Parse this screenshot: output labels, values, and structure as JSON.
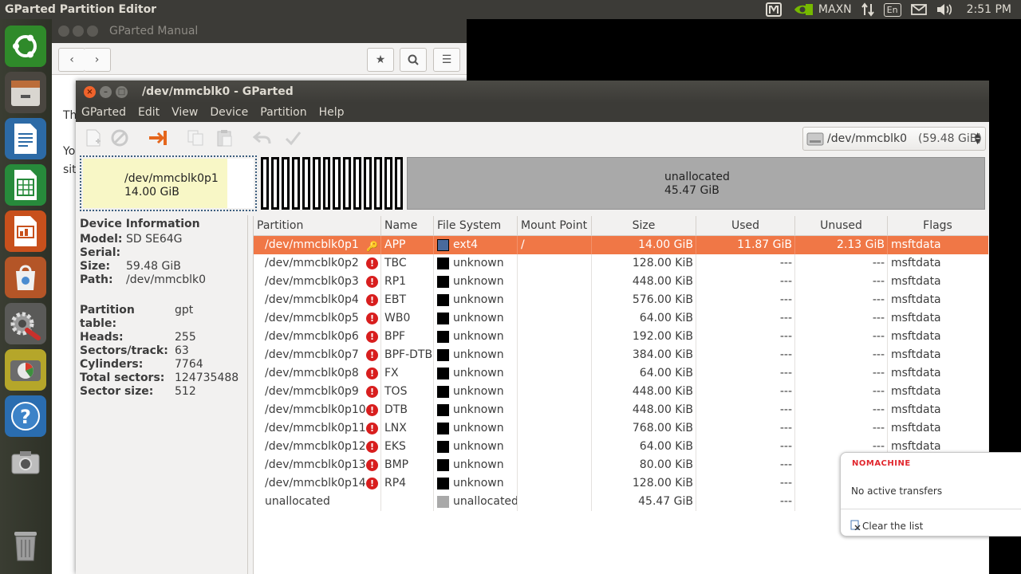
{
  "top_panel": {
    "app_title": "GParted Partition Editor",
    "keyboard_indicator": "MAXN",
    "language": "En",
    "clock": "2:51 PM"
  },
  "launcher": {
    "items": [
      "ubuntu-dash",
      "files",
      "writer",
      "calc",
      "impress",
      "software-center",
      "system-settings",
      "gparted",
      "help",
      "screenshot",
      "trash"
    ]
  },
  "manual_window": {
    "title": "GParted Manual",
    "body_lines": [
      "Th",
      "Yo",
      "sit"
    ]
  },
  "gparted": {
    "title": "/dev/mmcblk0 - GParted",
    "menu": [
      "GParted",
      "Edit",
      "View",
      "Device",
      "Partition",
      "Help"
    ],
    "device_selector": {
      "device": "/dev/mmcblk0",
      "size": "(59.48 GiB)"
    },
    "map": {
      "p1_name": "/dev/mmcblk0p1",
      "p1_size": "14.00 GiB",
      "p1_used_fraction": 0.848,
      "unalloc_name": "unallocated",
      "unalloc_size": "45.47 GiB"
    },
    "device_info": {
      "header": "Device Information",
      "group1": [
        {
          "k": "Model:",
          "v": "SD SE64G"
        },
        {
          "k": "Serial:",
          "v": ""
        },
        {
          "k": "Size:",
          "v": "59.48 GiB"
        },
        {
          "k": "Path:",
          "v": "/dev/mmcblk0"
        }
      ],
      "group2": [
        {
          "k": "Partition table:",
          "v": "gpt"
        },
        {
          "k": "Heads:",
          "v": "255"
        },
        {
          "k": "Sectors/track:",
          "v": "63"
        },
        {
          "k": "Cylinders:",
          "v": "7764"
        },
        {
          "k": "Total sectors:",
          "v": "124735488"
        },
        {
          "k": "Sector size:",
          "v": "512"
        }
      ]
    },
    "columns": [
      "Partition",
      "Name",
      "File System",
      "Mount Point",
      "Size",
      "Used",
      "Unused",
      "Flags"
    ],
    "rows": [
      {
        "p": "/dev/mmcblk0p1",
        "n": "APP",
        "fs": "ext4",
        "fsc": "#4a6a9c",
        "mp": "/",
        "size": "14.00 GiB",
        "used": "11.87 GiB",
        "unused": "2.13 GiB",
        "flags": "msftdata",
        "status": "key",
        "selected": true
      },
      {
        "p": "/dev/mmcblk0p2",
        "n": "TBC",
        "fs": "unknown",
        "fsc": "#000000",
        "mp": "",
        "size": "128.00 KiB",
        "used": "---",
        "unused": "---",
        "flags": "msftdata",
        "status": "warn"
      },
      {
        "p": "/dev/mmcblk0p3",
        "n": "RP1",
        "fs": "unknown",
        "fsc": "#000000",
        "mp": "",
        "size": "448.00 KiB",
        "used": "---",
        "unused": "---",
        "flags": "msftdata",
        "status": "warn"
      },
      {
        "p": "/dev/mmcblk0p4",
        "n": "EBT",
        "fs": "unknown",
        "fsc": "#000000",
        "mp": "",
        "size": "576.00 KiB",
        "used": "---",
        "unused": "---",
        "flags": "msftdata",
        "status": "warn"
      },
      {
        "p": "/dev/mmcblk0p5",
        "n": "WB0",
        "fs": "unknown",
        "fsc": "#000000",
        "mp": "",
        "size": "64.00 KiB",
        "used": "---",
        "unused": "---",
        "flags": "msftdata",
        "status": "warn"
      },
      {
        "p": "/dev/mmcblk0p6",
        "n": "BPF",
        "fs": "unknown",
        "fsc": "#000000",
        "mp": "",
        "size": "192.00 KiB",
        "used": "---",
        "unused": "---",
        "flags": "msftdata",
        "status": "warn"
      },
      {
        "p": "/dev/mmcblk0p7",
        "n": "BPF-DTB",
        "fs": "unknown",
        "fsc": "#000000",
        "mp": "",
        "size": "384.00 KiB",
        "used": "---",
        "unused": "---",
        "flags": "msftdata",
        "status": "warn"
      },
      {
        "p": "/dev/mmcblk0p8",
        "n": "FX",
        "fs": "unknown",
        "fsc": "#000000",
        "mp": "",
        "size": "64.00 KiB",
        "used": "---",
        "unused": "---",
        "flags": "msftdata",
        "status": "warn"
      },
      {
        "p": "/dev/mmcblk0p9",
        "n": "TOS",
        "fs": "unknown",
        "fsc": "#000000",
        "mp": "",
        "size": "448.00 KiB",
        "used": "---",
        "unused": "---",
        "flags": "msftdata",
        "status": "warn"
      },
      {
        "p": "/dev/mmcblk0p10",
        "n": "DTB",
        "fs": "unknown",
        "fsc": "#000000",
        "mp": "",
        "size": "448.00 KiB",
        "used": "---",
        "unused": "---",
        "flags": "msftdata",
        "status": "warn"
      },
      {
        "p": "/dev/mmcblk0p11",
        "n": "LNX",
        "fs": "unknown",
        "fsc": "#000000",
        "mp": "",
        "size": "768.00 KiB",
        "used": "---",
        "unused": "---",
        "flags": "msftdata",
        "status": "warn"
      },
      {
        "p": "/dev/mmcblk0p12",
        "n": "EKS",
        "fs": "unknown",
        "fsc": "#000000",
        "mp": "",
        "size": "64.00 KiB",
        "used": "---",
        "unused": "---",
        "flags": "msftdata",
        "status": "warn"
      },
      {
        "p": "/dev/mmcblk0p13",
        "n": "BMP",
        "fs": "unknown",
        "fsc": "#000000",
        "mp": "",
        "size": "80.00 KiB",
        "used": "---",
        "unused": "",
        "flags": "",
        "status": "warn"
      },
      {
        "p": "/dev/mmcblk0p14",
        "n": "RP4",
        "fs": "unknown",
        "fsc": "#000000",
        "mp": "",
        "size": "128.00 KiB",
        "used": "---",
        "unused": "",
        "flags": "",
        "status": "warn"
      },
      {
        "p": "unallocated",
        "n": "",
        "fs": "unallocated",
        "fsc": "#a9a9a9",
        "mp": "",
        "size": "45.47 GiB",
        "used": "---",
        "unused": "",
        "flags": "",
        "status": "none"
      }
    ]
  },
  "nomachine": {
    "brand": "NOMACHINE",
    "message": "No active transfers",
    "clear_label": "Clear the list"
  }
}
